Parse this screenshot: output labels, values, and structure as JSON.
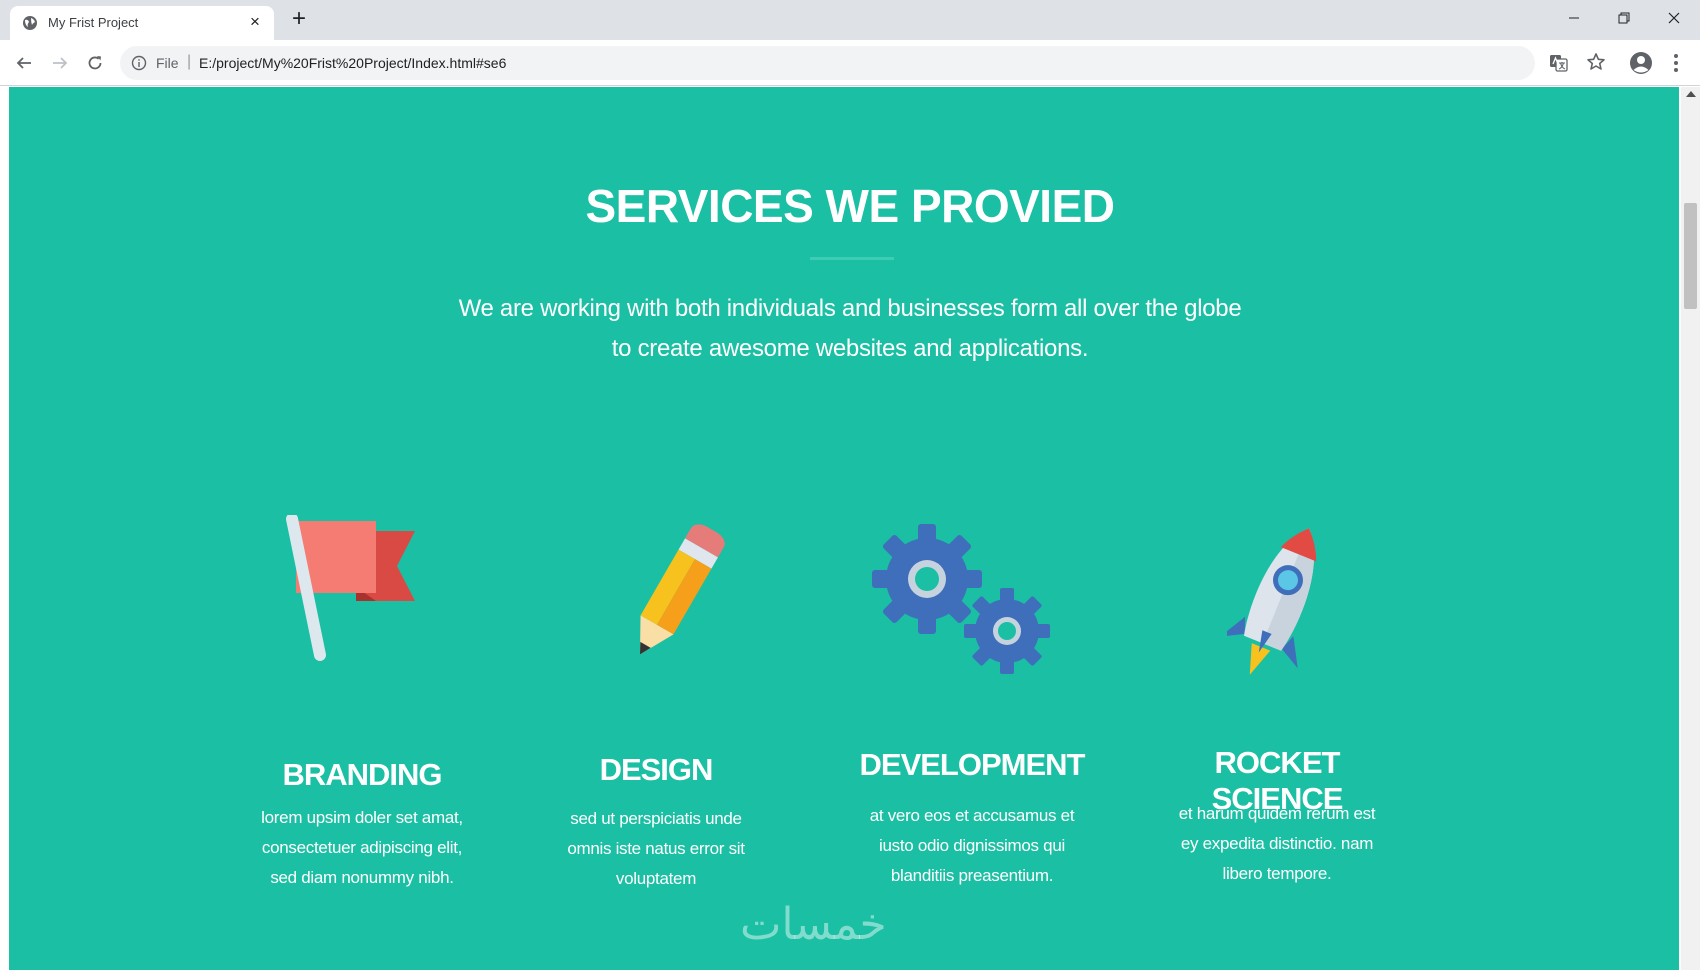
{
  "browser": {
    "tab_title": "My Frist Project",
    "tab_close": "×",
    "new_tab": "+",
    "file_label": "File",
    "url_separator": "|",
    "url": "E:/project/My%20Frist%20Project/Index.html#se6"
  },
  "page": {
    "heading": "SERVICES WE PROVIED",
    "subline_1": "We are working with both individuals and businesses form all over the globe",
    "subline_2": "to create awesome websites and applications.",
    "services": [
      {
        "icon": "flag-icon",
        "title": "BRANDING",
        "desc": [
          "lorem upsim doler set amat,",
          "consectetuer adipiscing elit,",
          "sed diam nonummy nibh."
        ]
      },
      {
        "icon": "pencil-icon",
        "title": "DESIGN",
        "desc": [
          "sed ut perspiciatis unde",
          "omnis iste natus error sit",
          "voluptatem"
        ]
      },
      {
        "icon": "gears-icon",
        "title": "DEVELOPMENT",
        "desc": [
          "at vero eos et accusamus et",
          "iusto odio dignissimos qui",
          "blanditiis preasentium."
        ]
      },
      {
        "icon": "rocket-icon",
        "title": "ROCKET SCIENCE",
        "desc": [
          "et harum quidem rerum est",
          "ey expedita distinctio. nam",
          "libero tempore."
        ]
      }
    ],
    "watermark": "خمسات"
  },
  "colors": {
    "section_bg": "#1abfa4",
    "flag_red": "#f47c72",
    "pencil_yellow": "#f7c21d",
    "gear_blue": "#3f6fba",
    "rocket_body": "#dde4ec"
  }
}
